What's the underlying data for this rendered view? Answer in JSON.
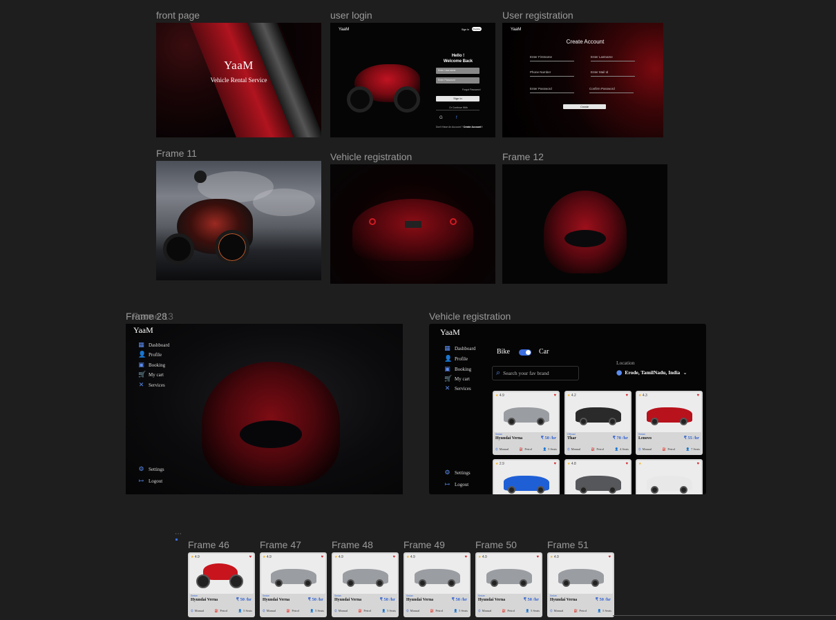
{
  "labels": {
    "front_page": "front page",
    "user_login": "user login",
    "user_registration": "User registration",
    "frame_11": "Frame 11",
    "vehicle_registration_1": "Vehicle registration",
    "frame_12": "Frame 12",
    "frame_overlap": "Frame 28",
    "frame_overlap_b": "Frame 13",
    "vehicle_registration_2": "Vehicle registration",
    "small_frames": [
      "Frame 46",
      "Frame 47",
      "Frame 48",
      "Frame 49",
      "Frame 50",
      "Frame 51"
    ]
  },
  "front": {
    "logo": "YaaM",
    "tagline": "Vehicle Rental Service"
  },
  "login": {
    "logo": "YaaM",
    "nav_signin": "Sign In",
    "nav_register": "Register",
    "greeting_1": "Hello !",
    "greeting_2": "Welcome Back",
    "username_placeholder": "Enter Username",
    "password_placeholder": "Enter Password",
    "forgot": "Forgot Password",
    "signin_button": "Sign In",
    "continue_with": "Or Continue With",
    "no_account": "Don't Have An Account ?",
    "create_account_link": "Create Account !"
  },
  "registration": {
    "logo": "YaaM",
    "title": "Create  Account",
    "fields": [
      "Enter Firstname",
      "Enter Lastname",
      "Phone Number",
      "Enter Mail Id",
      "Enter Password",
      "Confirm Password"
    ],
    "create_button": "Create"
  },
  "dashboard": {
    "logo": "YaaM",
    "menu": [
      "Dashboard",
      "Profile",
      "Booking",
      "My cart",
      "Services"
    ],
    "settings": "Settings",
    "logout": "Logout"
  },
  "vehicle_page": {
    "logo": "YaaM",
    "menu": [
      "Dashboard",
      "Profile",
      "Booking",
      "My cart",
      "Services"
    ],
    "settings": "Settings",
    "logout": "Logout",
    "toggle_left": "Bike",
    "toggle_right": "Car",
    "toggle_state": "Car",
    "search_placeholder": "Search your fav brand",
    "location_label": "Location",
    "location_value": "Erode, TamilNadu, India",
    "cards": [
      {
        "rating": "4.9",
        "sub": "Sedan",
        "name": "Hyundai Verna",
        "price": "₹ 50 /hr",
        "gear": "Manual",
        "fuel": "Petrol",
        "seats": "5 Seats",
        "color": "#9a9da2"
      },
      {
        "rating": "4.2",
        "sub": "Offroad",
        "name": "Thar",
        "price": "₹ 70 /hr",
        "gear": "Manual",
        "fuel": "Petrol",
        "seats": "4 Seats",
        "color": "#2a2a2a"
      },
      {
        "rating": "4.3",
        "sub": "Sedan",
        "name": "Lenovo",
        "price": "₹ 55 /hr",
        "gear": "Manual",
        "fuel": "Petrol",
        "seats": "7 Seats",
        "color": "#b8121c"
      },
      {
        "rating": "2.9",
        "sub": "",
        "name": "",
        "price": "",
        "gear": "",
        "fuel": "",
        "seats": "",
        "color": "#1f5fd6"
      },
      {
        "rating": "4.8",
        "sub": "",
        "name": "",
        "price": "",
        "gear": "",
        "fuel": "",
        "seats": "",
        "color": "#55575b"
      },
      {
        "rating": "",
        "sub": "",
        "name": "",
        "price": "",
        "gear": "",
        "fuel": "",
        "seats": "",
        "color": "#e8e8e8"
      }
    ]
  },
  "small_cards": [
    {
      "rating": "4.9",
      "sub": "Sedan",
      "name": "Hyundai Verna",
      "price": "₹ 50 /hr",
      "gear": "Manual",
      "fuel": "Petrol",
      "seats": "5 Seats",
      "color": "#c8141c"
    },
    {
      "rating": "4.9",
      "sub": "Sedan",
      "name": "Hyundai Verna",
      "price": "₹ 50 /hr",
      "gear": "Manual",
      "fuel": "Petrol",
      "seats": "5 Seats",
      "color": "#9a9da2"
    },
    {
      "rating": "4.9",
      "sub": "Sedan",
      "name": "Hyundai Verna",
      "price": "₹ 50 /hr",
      "gear": "Manual",
      "fuel": "Petrol",
      "seats": "5 Seats",
      "color": "#9a9da2"
    },
    {
      "rating": "4.9",
      "sub": "Sedan",
      "name": "Hyundai Verna",
      "price": "₹ 50 /hr",
      "gear": "Manual",
      "fuel": "Petrol",
      "seats": "5 Seats",
      "color": "#9a9da2"
    },
    {
      "rating": "4.9",
      "sub": "Sedan",
      "name": "Hyundai Verna",
      "price": "₹ 50 /hr",
      "gear": "Manual",
      "fuel": "Petrol",
      "seats": "5 Seats",
      "color": "#9a9da2"
    },
    {
      "rating": "4.9",
      "sub": "Sedan",
      "name": "Hyundai Verna",
      "price": "₹ 50 /hr",
      "gear": "Manual",
      "fuel": "Petrol",
      "seats": "5 Seats",
      "color": "#9a9da2"
    }
  ],
  "colors": {
    "canvas": "#1e1e1e",
    "accent": "#5b8cf0",
    "price_blue": "#2d5fd0",
    "heart_red": "#d5242b",
    "brand_red": "#b0141f"
  }
}
